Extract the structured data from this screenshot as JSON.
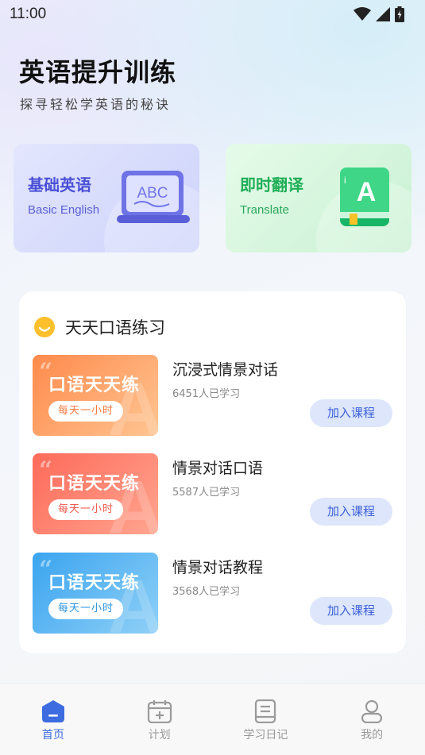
{
  "status_bar": {
    "time": "11:00"
  },
  "header": {
    "title": "英语提升训练",
    "subtitle": "探寻轻松学英语的秘诀"
  },
  "features": [
    {
      "title": "基础英语",
      "subtitle": "Basic English",
      "icon": "abc-laptop-icon",
      "illus_text": "ABC"
    },
    {
      "title": "即时翻译",
      "subtitle": "Translate",
      "icon": "book-a-icon",
      "illus_text": "A"
    }
  ],
  "section": {
    "title": "天天口语练习",
    "icon": "smile-icon",
    "courses": [
      {
        "thumb_title": "口语天天练",
        "thumb_tag": "每天一小时",
        "name": "沉浸式情景对话",
        "learners": "6451人已学习",
        "button": "加入课程",
        "color": "orange"
      },
      {
        "thumb_title": "口语天天练",
        "thumb_tag": "每天一小时",
        "name": "情景对话口语",
        "learners": "5587人已学习",
        "button": "加入课程",
        "color": "red"
      },
      {
        "thumb_title": "口语天天练",
        "thumb_tag": "每天一小时",
        "name": "情景对话教程",
        "learners": "3568人已学习",
        "button": "加入课程",
        "color": "blue"
      }
    ]
  },
  "tabbar": [
    {
      "label": "首页",
      "icon": "home-icon",
      "active": true
    },
    {
      "label": "计划",
      "icon": "calendar-plus-icon",
      "active": false
    },
    {
      "label": "学习日记",
      "icon": "notebook-icon",
      "active": false
    },
    {
      "label": "我的",
      "icon": "user-icon",
      "active": false
    }
  ],
  "colors": {
    "accent": "#3d6ce0",
    "join_button_bg": "#dde6fb",
    "basic_card": "#cdd3fb",
    "translate_card": "#c9f1d3"
  }
}
